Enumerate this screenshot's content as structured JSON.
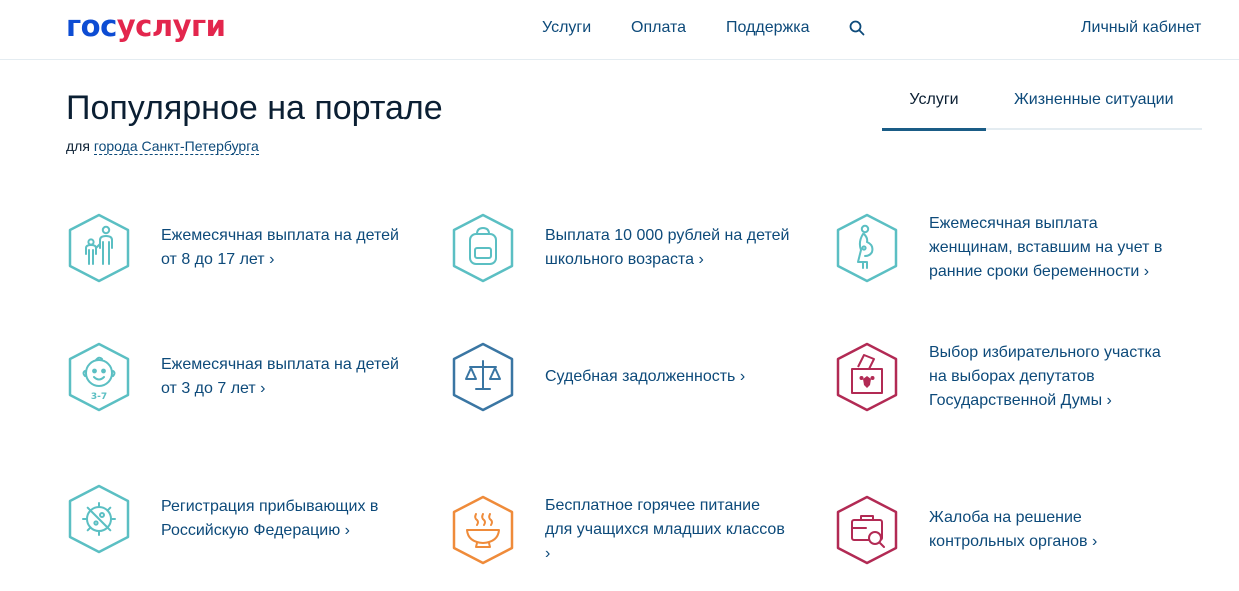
{
  "header": {
    "logo_part1": "гос",
    "logo_part2": "услуги",
    "nav": [
      "Услуги",
      "Оплата",
      "Поддержка"
    ],
    "search_icon": "search-icon",
    "cabinet": "Личный кабинет"
  },
  "page": {
    "title": "Популярное на портале",
    "city_prefix": "для",
    "city_link": "города Санкт-Петербурга"
  },
  "tabs": [
    "Услуги",
    "Жизненные ситуации"
  ],
  "colors": {
    "teal": "#5bbfc3",
    "blue": "#3a76a3",
    "orange": "#ef8b3a",
    "crimson": "#b22a54",
    "link": "#0d4a7a",
    "logo_blue": "#0d4cd3",
    "logo_red": "#e3264d"
  },
  "services": [
    {
      "label": "Ежемесячная выплата на детей от 8 до 17 лет",
      "icon": "children-icon",
      "color": "teal"
    },
    {
      "label": "Выплата 10 000 рублей на детей школьного возраста",
      "icon": "backpack-icon",
      "color": "teal"
    },
    {
      "label": "Ежемесячная выплата женщинам, вставшим на учет в ранние сроки беременности",
      "icon": "pregnant-woman-icon",
      "color": "teal"
    },
    {
      "label": "Ежемесячная выплата на детей от 3 до 7 лет",
      "icon": "baby-3-7-icon",
      "icon_text": "3-7",
      "color": "teal"
    },
    {
      "label": "Судебная задолженность",
      "icon": "scales-icon",
      "color": "blue"
    },
    {
      "label": "Выбор избирательного участка на выборах депутатов Государственной Думы",
      "icon": "ballot-box-icon",
      "color": "crimson"
    },
    {
      "label": "Регистрация прибывающих в Российскую Федерацию",
      "icon": "virus-icon",
      "color": "teal"
    },
    {
      "label": "Бесплатное горячее питание для учащихся младших классов",
      "icon": "hot-meal-icon",
      "color": "orange"
    },
    {
      "label": "Жалоба на решение контрольных органов",
      "icon": "complaint-briefcase-icon",
      "color": "crimson"
    }
  ]
}
